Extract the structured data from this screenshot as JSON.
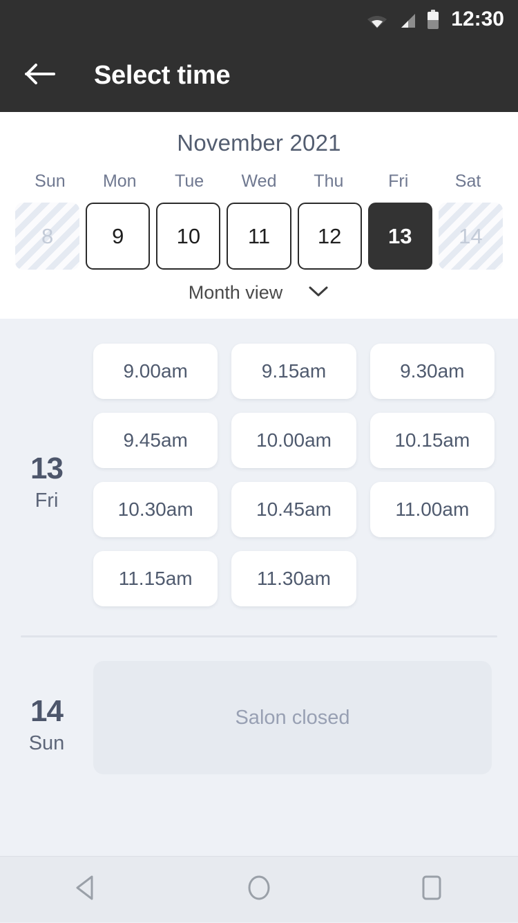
{
  "statusbar": {
    "time": "12:30",
    "icons": [
      "wifi-icon",
      "cellular-signal-icon",
      "battery-icon"
    ]
  },
  "appbar": {
    "back_icon": "arrow-left-icon",
    "title": "Select time"
  },
  "calendar": {
    "month_label": "November 2021",
    "weekdays": [
      "Sun",
      "Mon",
      "Tue",
      "Wed",
      "Thu",
      "Fri",
      "Sat"
    ],
    "days": [
      {
        "number": "8",
        "state": "disabled"
      },
      {
        "number": "9",
        "state": "available"
      },
      {
        "number": "10",
        "state": "available"
      },
      {
        "number": "11",
        "state": "available"
      },
      {
        "number": "12",
        "state": "available"
      },
      {
        "number": "13",
        "state": "selected"
      },
      {
        "number": "14",
        "state": "disabled"
      }
    ],
    "view_toggle": {
      "label": "Month view",
      "icon": "chevron-down-icon"
    }
  },
  "schedule": [
    {
      "day_number": "13",
      "day_name": "Fri",
      "slots": [
        "9.00am",
        "9.15am",
        "9.30am",
        "9.45am",
        "10.00am",
        "10.15am",
        "10.30am",
        "10.45am",
        "11.00am",
        "11.15am",
        "11.30am"
      ]
    },
    {
      "day_number": "14",
      "day_name": "Sun",
      "closed_label": "Salon closed"
    }
  ],
  "navbar": {
    "back": "back-triangle-icon",
    "home": "home-circle-icon",
    "recents": "recents-square-icon"
  },
  "colors": {
    "appbar_bg": "#303030",
    "page_bg": "#eef1f6",
    "selected_day_bg": "#333333",
    "heading_text": "#535d70",
    "slot_text": "#4f5a6e",
    "closed_card_bg": "#e6eaf0"
  }
}
